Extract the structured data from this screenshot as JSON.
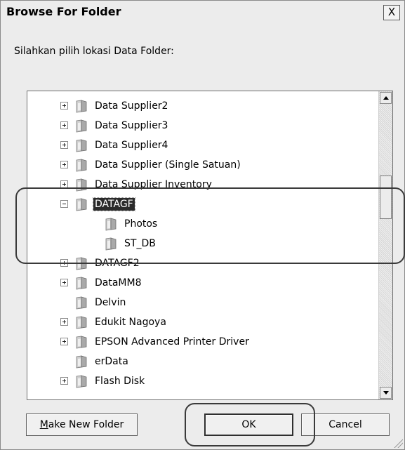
{
  "dialog": {
    "title": "Browse For Folder",
    "close_label": "X",
    "prompt": "Silahkan pilih lokasi Data Folder:"
  },
  "tree": {
    "items": [
      {
        "label": "Data Supplier2",
        "expander": "plus",
        "level": 0,
        "selected": false
      },
      {
        "label": "Data Supplier3",
        "expander": "plus",
        "level": 0,
        "selected": false
      },
      {
        "label": "Data Supplier4",
        "expander": "plus",
        "level": 0,
        "selected": false
      },
      {
        "label": "Data Supplier (Single Satuan)",
        "expander": "plus",
        "level": 0,
        "selected": false
      },
      {
        "label": "Data Supplier Inventory",
        "expander": "plus",
        "level": 0,
        "selected": false
      },
      {
        "label": "DATAGF",
        "expander": "minus",
        "level": 0,
        "selected": true
      },
      {
        "label": "Photos",
        "expander": "none",
        "level": 1,
        "selected": false
      },
      {
        "label": "ST_DB",
        "expander": "none",
        "level": 1,
        "selected": false
      },
      {
        "label": "DATAGF2",
        "expander": "plus",
        "level": 0,
        "selected": false
      },
      {
        "label": "DataMM8",
        "expander": "plus",
        "level": 0,
        "selected": false
      },
      {
        "label": "Delvin",
        "expander": "none",
        "level": 0,
        "selected": false
      },
      {
        "label": "Edukit Nagoya",
        "expander": "plus",
        "level": 0,
        "selected": false
      },
      {
        "label": "EPSON Advanced Printer Driver",
        "expander": "plus",
        "level": 0,
        "selected": false
      },
      {
        "label": "erData",
        "expander": "none",
        "level": 0,
        "selected": false
      },
      {
        "label": "Flash Disk",
        "expander": "plus",
        "level": 0,
        "selected": false
      }
    ]
  },
  "buttons": {
    "make_new_folder_mnemonic": "M",
    "make_new_folder_rest": "ake New Folder",
    "ok": "OK",
    "cancel": "Cancel"
  }
}
